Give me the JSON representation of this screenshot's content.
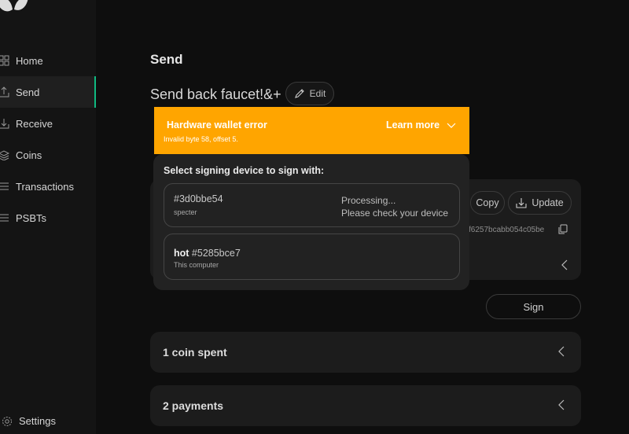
{
  "sidebar": {
    "items": [
      {
        "label": "Home",
        "icon": "home-grid-icon"
      },
      {
        "label": "Send",
        "icon": "send-icon",
        "active": true
      },
      {
        "label": "Receive",
        "icon": "receive-icon"
      },
      {
        "label": "Coins",
        "icon": "coins-icon"
      },
      {
        "label": "Transactions",
        "icon": "list-icon"
      },
      {
        "label": "PSBTs",
        "icon": "list-icon"
      }
    ],
    "settings_label": "Settings"
  },
  "main": {
    "title": "Send",
    "tx_label": "Send back faucet!&+",
    "edit_label": "Edit",
    "copy_label": "Copy",
    "update_label": "Update",
    "txid": "f6257bcabb054c05be",
    "sign_label": "Sign",
    "coins_spent": "1 coin spent",
    "payments": "2 payments"
  },
  "modal": {
    "title": "Select signing device to sign with:",
    "devices": [
      {
        "name": "#3d0bbe54",
        "sub": "specter",
        "status_line1": "Processing...",
        "status_line2": "Please check your device"
      },
      {
        "alias": "hot",
        "name": "#5285bce7",
        "sub": "This computer"
      }
    ]
  },
  "error_banner": {
    "title": "Hardware wallet error",
    "message": "Invalid byte 58, offset 5.",
    "learn_more": "Learn more",
    "color": "#ffa500"
  },
  "colors": {
    "accent": "#10b981",
    "background": "#0e0e0e",
    "card": "#1c1c1c"
  }
}
